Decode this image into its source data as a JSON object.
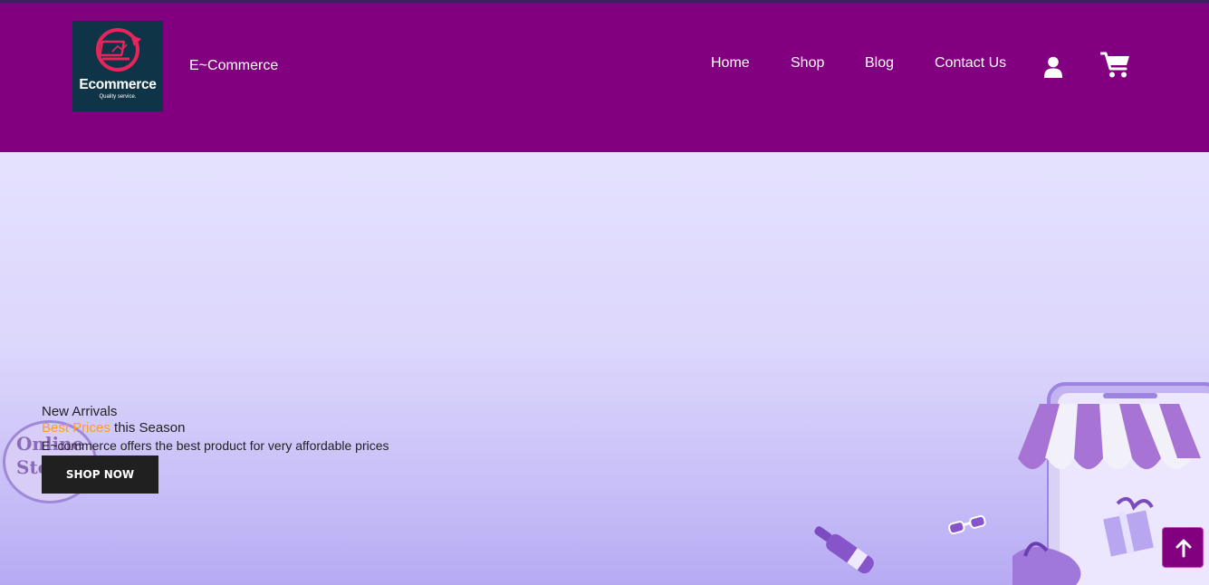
{
  "logo": {
    "title": "Ecommerce",
    "tagline": "Quality service.",
    "colors": {
      "background": "#0f3448",
      "ring": "#e8245c"
    }
  },
  "brand": "E~Commerce",
  "nav": {
    "items": [
      {
        "label": "Home"
      },
      {
        "label": "Shop"
      },
      {
        "label": "Blog"
      },
      {
        "label": "Contact Us"
      }
    ],
    "icons": {
      "account": "user-icon",
      "cart": "cart-icon"
    }
  },
  "hero": {
    "line1": "New Arrivals",
    "line2_accent": "Best Prices",
    "line2_rest": " this Season",
    "line3": "E~commerce offers the best product for very affordable prices",
    "cta": "SHOP NOW",
    "badge_text": "Online Store"
  },
  "scroll_top": {
    "icon": "arrow-up-icon"
  },
  "colors": {
    "header": "#820080",
    "accent": "#ff9e1b",
    "button": "#202020",
    "hero_gradient": [
      "#e5e1ff",
      "#b7aaf3"
    ]
  }
}
